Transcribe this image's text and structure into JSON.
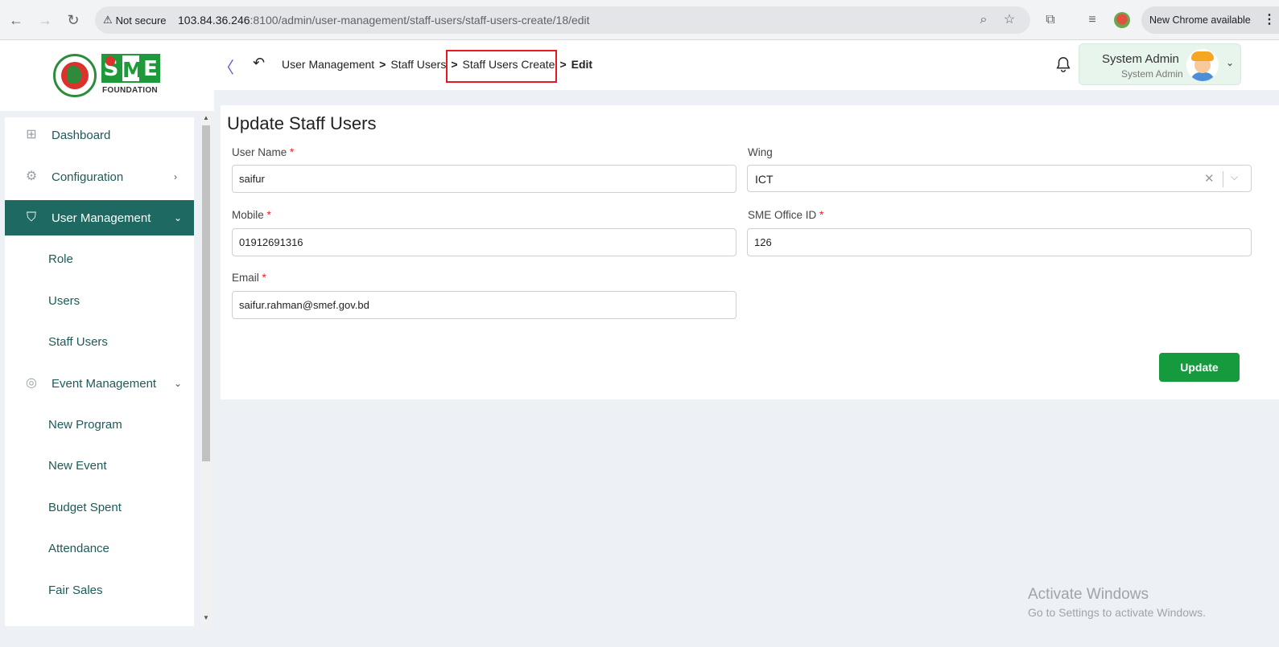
{
  "browser": {
    "security_label": "Not secure",
    "url_host": "103.84.36.246",
    "url_rest": ":8100/admin/user-management/staff-users/staff-users-create/18/edit",
    "new_chrome_label": "New Chrome available"
  },
  "logo": {
    "letters": [
      "S",
      "M",
      "E"
    ],
    "subtitle": "FOUNDATION"
  },
  "sidebar": {
    "items": [
      {
        "label": "Dashboard",
        "icon": "grid-icon"
      },
      {
        "label": "Configuration",
        "icon": "config-icon"
      },
      {
        "label": "User Management",
        "icon": "shield-user-icon",
        "active": true
      },
      {
        "label": "Event Management",
        "icon": "lock-icon"
      }
    ],
    "user_management_children": [
      "Role",
      "Users",
      "Staff Users"
    ],
    "event_management_children": [
      "New Program",
      "New Event",
      "Budget Spent",
      "Attendance",
      "Fair Sales"
    ]
  },
  "header": {
    "breadcrumb": [
      "User Management",
      "Staff Users",
      "Staff Users Create",
      "Edit"
    ],
    "user_name": "System Admin",
    "user_role": "System Admin"
  },
  "form": {
    "title": "Update Staff Users",
    "user_name_label": "User Name",
    "user_name_value": "saifur",
    "wing_label": "Wing",
    "wing_value": "ICT",
    "mobile_label": "Mobile",
    "mobile_value": "01912691316",
    "office_label": "SME Office ID",
    "office_value": "126",
    "email_label": "Email",
    "email_value": "saifur.rahman@smef.gov.bd",
    "required_mark": "*",
    "submit_label": "Update"
  },
  "watermark": {
    "title": "Activate Windows",
    "subtitle": "Go to Settings to activate Windows."
  },
  "colors": {
    "accent": "#1e6a63",
    "button": "#159a3e",
    "highlight": "#e21b23"
  }
}
